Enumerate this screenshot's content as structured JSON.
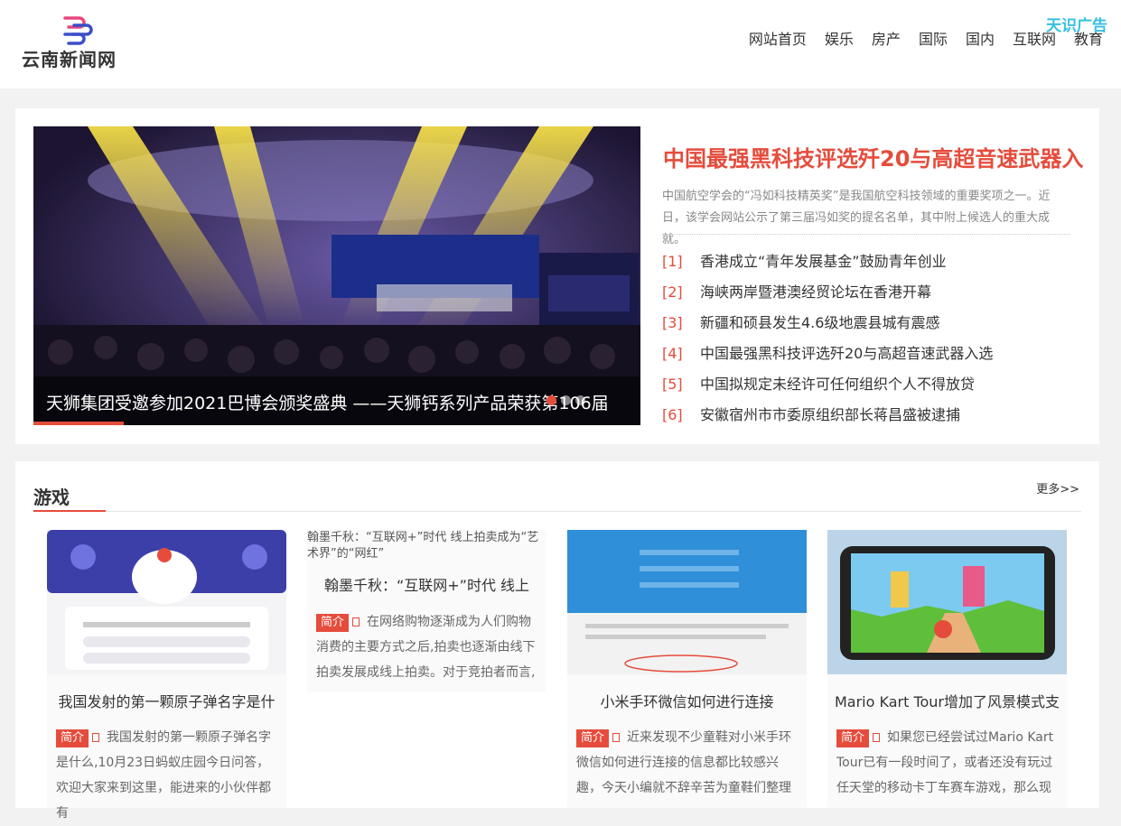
{
  "header": {
    "logo_text": "云南新闻网",
    "nav": [
      "网站首页",
      "娱乐",
      "房产",
      "国际",
      "国内",
      "互联网",
      "教育"
    ],
    "ad_label": "天识广告"
  },
  "slider": {
    "caption": "天狮集团受邀参加2021巴博会颁奖盛典 ——天狮钙系列产品荣获第106届"
  },
  "feature": {
    "headline": "中国最强黑科技评选歼20与高超音速武器入",
    "summary": "中国航空学会的“冯如科技精英奖”是我国航空科技领域的重要奖项之一。近日，该学会网站公示了第三届冯如奖的提名名单，其中附上候选人的重大成就。",
    "list": [
      {
        "num": "[1]",
        "title": "香港成立“青年发展基金”鼓励青年创业"
      },
      {
        "num": "[2]",
        "title": "海峡两岸暨港澳经贸论坛在香港开幕"
      },
      {
        "num": "[3]",
        "title": "新疆和硕县发生4.6级地震县城有震感"
      },
      {
        "num": "[4]",
        "title": "中国最强黑科技评选歼20与高超音速武器入选"
      },
      {
        "num": "[5]",
        "title": "中国拟规定未经许可任何组织个人不得放贷"
      },
      {
        "num": "[6]",
        "title": "安徽宿州市市委原组织部长蒋昌盛被逮捕"
      }
    ]
  },
  "games": {
    "title": "游戏",
    "more": "更多>>",
    "tag": "简介",
    "cards": [
      {
        "title": "我国发射的第一颗原子弹名字是什",
        "desc": "我国发射的第一颗原子弹名字是什么,10月23日蚂蚁庄园今日问答，欢迎大家来到这里，能进来的小伙伴都有"
      },
      {
        "alt": "翰墨千秋：“互联网+”时代 线上拍卖成为“艺术界”的“网红”",
        "title": "翰墨千秋：“互联网+”时代 线上",
        "desc": "在网络购物逐渐成为人们购物消费的主要方式之后,拍卖也逐渐由线下拍卖发展成线上拍卖。对于竞拍者而言,"
      },
      {
        "title": "小米手环微信如何进行连接",
        "desc": "近来发现不少童鞋对小米手环微信如何进行连接的信息都比较感兴趣，今天小编就不辞辛苦为童鞋们整理"
      },
      {
        "title": "Mario Kart Tour增加了风景模式支",
        "desc": "如果您已经尝试过Mario Kart Tour已有一段时间了，或者还没有玩过任天堂的移动卡丁车赛车游戏，那么现"
      }
    ]
  }
}
